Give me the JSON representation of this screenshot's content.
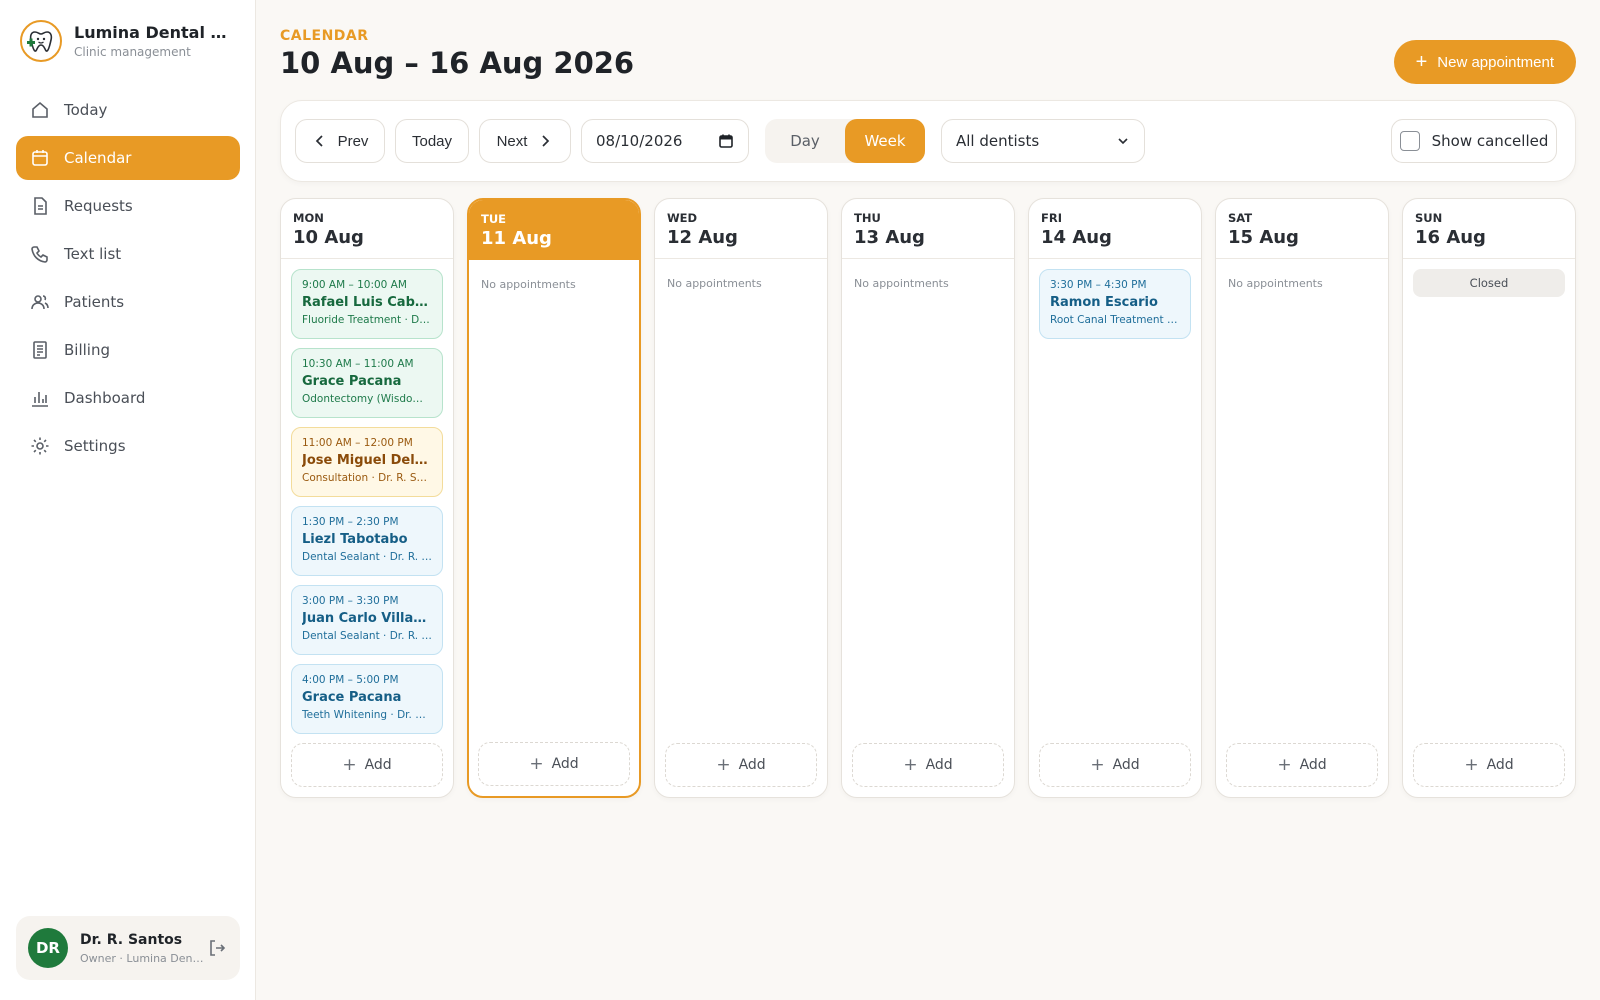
{
  "brand": {
    "name": "Lumina Dental Studio",
    "subtitle": "Clinic management"
  },
  "nav": [
    {
      "label": "Today",
      "icon": "home-icon"
    },
    {
      "label": "Calendar",
      "icon": "calendar-icon",
      "active": true
    },
    {
      "label": "Requests",
      "icon": "document-icon"
    },
    {
      "label": "Text list",
      "icon": "phone-icon"
    },
    {
      "label": "Patients",
      "icon": "users-icon"
    },
    {
      "label": "Billing",
      "icon": "receipt-icon"
    },
    {
      "label": "Dashboard",
      "icon": "bar-chart-icon"
    },
    {
      "label": "Settings",
      "icon": "gear-icon"
    }
  ],
  "user": {
    "initials": "DR",
    "name": "Dr. R. Santos",
    "role": "Owner · Lumina Dental Studio"
  },
  "header": {
    "eyebrow": "CALENDAR",
    "title": "10 Aug – 16 Aug 2026",
    "new_button": "New appointment"
  },
  "toolbar": {
    "prev": "Prev",
    "today": "Today",
    "next": "Next",
    "date_value": "08/10/2026",
    "view_day": "Day",
    "view_week": "Week",
    "active_view": "Week",
    "dentist_filter": "All dentists",
    "show_cancelled": "Show cancelled",
    "show_cancelled_checked": false
  },
  "week": {
    "empty_label": "No appointments",
    "closed_label": "Closed",
    "add_label": "Add",
    "days": [
      {
        "dow": "MON",
        "date": "10 Aug",
        "appointments": [
          {
            "time": "9:00 AM – 10:00 AM",
            "patient": "Rafael Luis Cabrera",
            "detail": "Fluoride Treatment · Dr. R. Santos",
            "color": "green"
          },
          {
            "time": "10:30 AM – 11:00 AM",
            "patient": "Grace Pacana",
            "detail": "Odontectomy (Wisdom Tooth) · Dr. R. Santos",
            "color": "green"
          },
          {
            "time": "11:00 AM – 12:00 PM",
            "patient": "Jose Miguel Dela Cruz",
            "detail": "Consultation · Dr. R. Santos",
            "color": "amber"
          },
          {
            "time": "1:30 PM – 2:30 PM",
            "patient": "Liezl Tabotabo",
            "detail": "Dental Sealant · Dr. R. Santos",
            "color": "blue"
          },
          {
            "time": "3:00 PM – 3:30 PM",
            "patient": "Juan Carlo Villanueva",
            "detail": "Dental Sealant · Dr. R. Santos",
            "color": "blue"
          },
          {
            "time": "4:00 PM – 5:00 PM",
            "patient": "Grace Pacana",
            "detail": "Teeth Whitening · Dr. R. Santos",
            "color": "blue"
          }
        ]
      },
      {
        "dow": "TUE",
        "date": "11 Aug",
        "today": true,
        "appointments": []
      },
      {
        "dow": "WED",
        "date": "12 Aug",
        "appointments": []
      },
      {
        "dow": "THU",
        "date": "13 Aug",
        "appointments": []
      },
      {
        "dow": "FRI",
        "date": "14 Aug",
        "appointments": [
          {
            "time": "3:30 PM – 4:30 PM",
            "patient": "Ramon Escario",
            "detail": "Root Canal Treatment · Dr. R. Santos",
            "color": "blue"
          }
        ]
      },
      {
        "dow": "SAT",
        "date": "15 Aug",
        "appointments": []
      },
      {
        "dow": "SUN",
        "date": "16 Aug",
        "closed": true,
        "appointments": []
      }
    ]
  },
  "colors": {
    "accent": "#e89a25",
    "avatar": "#1f7a3c"
  }
}
